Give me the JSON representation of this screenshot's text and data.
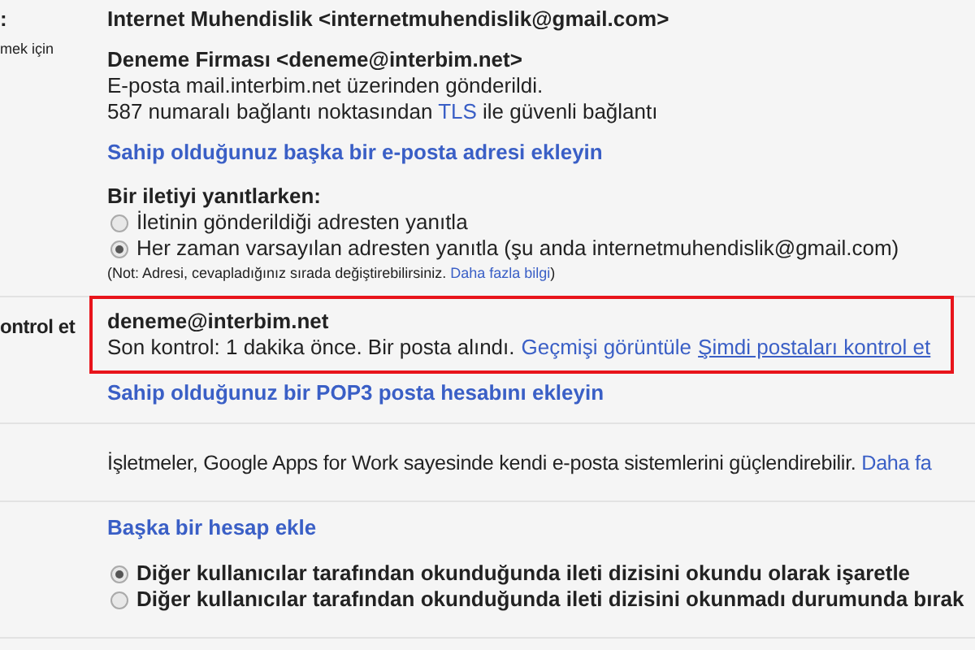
{
  "sections": [
    {
      "label": ":",
      "sublabel": "mek için",
      "account": "Internet Muhendislik <internetmuhendislik@gmail.com>",
      "from_name": "Deneme Firması <deneme@interbim.net>",
      "via": "E-posta mail.interbim.net üzerinden gönderildi.",
      "tls_prefix": "587 numaralı bağlantı noktasından",
      "tls_link": "TLS",
      "tls_suffix": "ile güvenli bağlantı",
      "add_link": "Sahip olduğunuz başka bir e-posta adresi ekleyin",
      "reply_title": "Bir iletiyi yanıtlarken:",
      "reply_options": [
        {
          "label": "İletinin gönderildiği adresten yanıtla",
          "selected": false
        },
        {
          "label": "Her zaman varsayılan adresten yanıtla (şu anda internetmuhendislik@gmail.com)",
          "selected": true
        }
      ],
      "note": "(Not: Adresi, cevapladığınız sırada değiştirebilirsiniz.",
      "note_link": "Daha fazla bilgi",
      "note_end": ")"
    },
    {
      "label": "ontrol et",
      "pop_account": "deneme@interbim.net",
      "status": "Son kontrol: 1 dakika önce. Bir posta alındı.",
      "history_link": "Geçmişi görüntüle",
      "check_link": "Şimdi postaları kontrol et",
      "add_pop_link": "Sahip olduğunuz bir POP3 posta hesabını ekleyin"
    },
    {
      "text": "İşletmeler, Google Apps for Work sayesinde kendi e-posta sistemlerini güçlendirebilir.",
      "link": "Daha fa"
    },
    {
      "add_account_link": "Başka bir hesap ekle",
      "mark_options": [
        {
          "label": "Diğer kullanıcılar tarafından okunduğunda ileti dizisini okundu olarak işaretle",
          "selected": true
        },
        {
          "label": "Diğer kullanıcılar tarafından okunduğunda ileti dizisini okunmadı durumunda bırak",
          "selected": false
        }
      ]
    }
  ]
}
